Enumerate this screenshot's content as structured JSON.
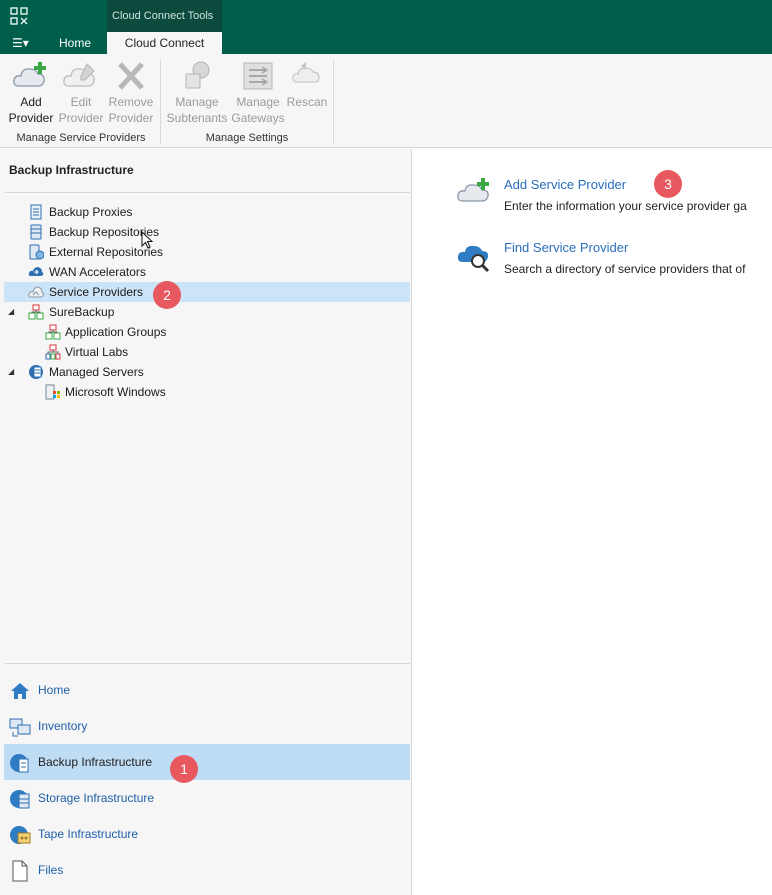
{
  "titlebar": {
    "app_icon": "veeam-app-icon",
    "context_tab": "Cloud Connect Tools"
  },
  "tabs": {
    "menu_icon": "hamburger-menu-icon",
    "home": "Home",
    "cloud_connect": "Cloud Connect"
  },
  "ribbon": {
    "buttons": [
      {
        "line1": "Add",
        "line2": "Provider",
        "icon": "cloud-add-icon",
        "enabled": true
      },
      {
        "line1": "Edit",
        "line2": "Provider",
        "icon": "cloud-edit-icon",
        "enabled": false
      },
      {
        "line1": "Remove",
        "line2": "Provider",
        "icon": "remove-x-icon",
        "enabled": false
      },
      {
        "line1": "Manage",
        "line2": "Subtenants",
        "icon": "subtenants-icon",
        "enabled": false
      },
      {
        "line1": "Manage",
        "line2": "Gateways",
        "icon": "gateways-icon",
        "enabled": false
      },
      {
        "line1": "Rescan",
        "line2": "",
        "icon": "rescan-icon",
        "enabled": false
      }
    ],
    "groups": [
      "Manage Service Providers",
      "Manage Settings"
    ]
  },
  "left_panel": {
    "title": "Backup Infrastructure",
    "tree": [
      {
        "label": "Backup Proxies",
        "icon": "backup-proxy-icon"
      },
      {
        "label": "Backup Repositories",
        "icon": "backup-repository-icon"
      },
      {
        "label": "External Repositories",
        "icon": "external-repository-icon"
      },
      {
        "label": "WAN Accelerators",
        "icon": "wan-accelerator-icon"
      },
      {
        "label": "Service Providers",
        "icon": "service-provider-icon",
        "selected": true
      },
      {
        "label": "SureBackup",
        "icon": "surebackup-icon",
        "expanded": true
      },
      {
        "label": "Application Groups",
        "icon": "application-group-icon"
      },
      {
        "label": "Virtual Labs",
        "icon": "virtual-lab-icon"
      },
      {
        "label": "Managed Servers",
        "icon": "managed-server-icon",
        "expanded": true
      },
      {
        "label": "Microsoft Windows",
        "icon": "windows-server-icon"
      }
    ],
    "nav": [
      {
        "label": "Home",
        "icon": "home-icon"
      },
      {
        "label": "Inventory",
        "icon": "inventory-icon"
      },
      {
        "label": "Backup Infrastructure",
        "icon": "backup-infrastructure-icon",
        "selected": true
      },
      {
        "label": "Storage Infrastructure",
        "icon": "storage-infrastructure-icon"
      },
      {
        "label": "Tape Infrastructure",
        "icon": "tape-infrastructure-icon"
      },
      {
        "label": "Files",
        "icon": "files-icon"
      }
    ]
  },
  "right_panel": {
    "actions": [
      {
        "title": "Add Service Provider",
        "description": "Enter the information your service provider ga",
        "icon": "cloud-add-icon"
      },
      {
        "title": "Find Service Provider",
        "description": "Search a directory of service providers that of",
        "icon": "cloud-search-icon"
      }
    ]
  },
  "badges": [
    "1",
    "2",
    "3"
  ],
  "colors": {
    "titlebar": "#005f4b",
    "accent_link": "#2a6ebb",
    "selection": "#cce4f7",
    "badge": "#e8585f"
  }
}
